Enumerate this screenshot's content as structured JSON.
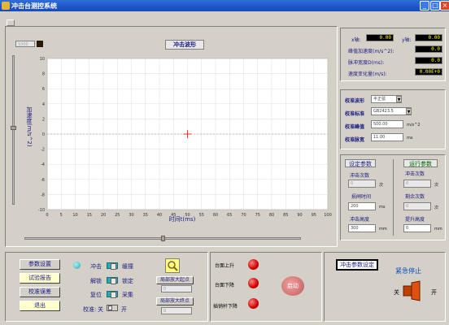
{
  "window": {
    "title": "冲击台测控系统",
    "min": "_",
    "max": "□",
    "close": "×"
  },
  "chart": {
    "title": "冲击波形",
    "top_input": "1000",
    "ylabel": "加速度(m/s^2)",
    "xlabel": "时间t(ms)"
  },
  "chart_data": {
    "type": "line",
    "title": "冲击波形",
    "xlabel": "时间t(ms)",
    "ylabel": "加速度(m/s^2)",
    "xlim": [
      0,
      100
    ],
    "ylim": [
      -10,
      10
    ],
    "x_ticks": [
      "0",
      "5",
      "10",
      "15",
      "20",
      "25",
      "30",
      "35",
      "40",
      "45",
      "50",
      "55",
      "60",
      "65",
      "70",
      "75",
      "80",
      "85",
      "90",
      "95",
      "100"
    ],
    "y_ticks": [
      "10",
      "8",
      "6",
      "4",
      "2",
      "0",
      "-2",
      "-4",
      "-6",
      "-8",
      "-10"
    ],
    "grid": true,
    "series": [
      {
        "values": []
      }
    ],
    "cursor": {
      "x": 50,
      "y": 0
    },
    "colors": {
      "axis_zero": "#aaaaaa",
      "grid": "#dddddd",
      "cursor": "#ff0000"
    }
  },
  "readouts": {
    "items": [
      {
        "label": "x轴:",
        "value": "0.00"
      },
      {
        "label": "y轴:",
        "value": "0.00"
      },
      {
        "label": "峰值加速度(m/s^2):",
        "value": "0.0"
      },
      {
        "label": "脉冲宽度D(ms):",
        "value": "0.0"
      },
      {
        "label": "速度变化量(m/s):",
        "value": "0.00E+0"
      }
    ]
  },
  "calibration": {
    "wave_label": "校准波形",
    "wave_value": "半正弦",
    "std_label": "校准标准",
    "std_value": "GB2423.5",
    "peak_label": "校准峰值",
    "peak_value": "500.00",
    "peak_unit": "m/s^2",
    "width_label": "校准脉宽",
    "width_value": "11.00",
    "width_unit": "ms"
  },
  "set_params": {
    "title": "设定参数",
    "count_label": "冲击次数",
    "count_value": "0",
    "count_unit": "次",
    "interval_label": "损闸时间",
    "interval_value": "200",
    "interval_unit": "ms",
    "height_label": "冲击高度",
    "height_value": "300",
    "height_unit": "mm"
  },
  "run_params": {
    "title": "运行参数",
    "count_label": "冲击次数",
    "count_value": "0",
    "count_unit": "次",
    "remain_label": "剩余次数",
    "remain_value": "0",
    "remain_unit": "次",
    "lift_label": "提升高度",
    "lift_value": "0",
    "lift_unit": "mm"
  },
  "left_buttons": [
    "参数设置",
    "试验报告",
    "校准误差",
    "退出"
  ],
  "toggles": [
    {
      "left": "冲击",
      "right": "缓撞"
    },
    {
      "left": "解锁",
      "right": "锁定"
    },
    {
      "left": "复位",
      "right": "采集"
    }
  ],
  "calib_switch": {
    "label": "校准:",
    "off": "关",
    "on": "开"
  },
  "zoom": {
    "point_label": "局部放大起点",
    "point_value": "0",
    "end_label": "局部放大终点",
    "end_value": "0"
  },
  "table_status": [
    {
      "label": "台面上升"
    },
    {
      "label": "台面下降"
    },
    {
      "label": "插销杆下降"
    }
  ],
  "center_button": "启动",
  "impact_params_button": "冲击参数设定",
  "estop": {
    "title": "紧急停止",
    "off": "关",
    "on": "开"
  }
}
